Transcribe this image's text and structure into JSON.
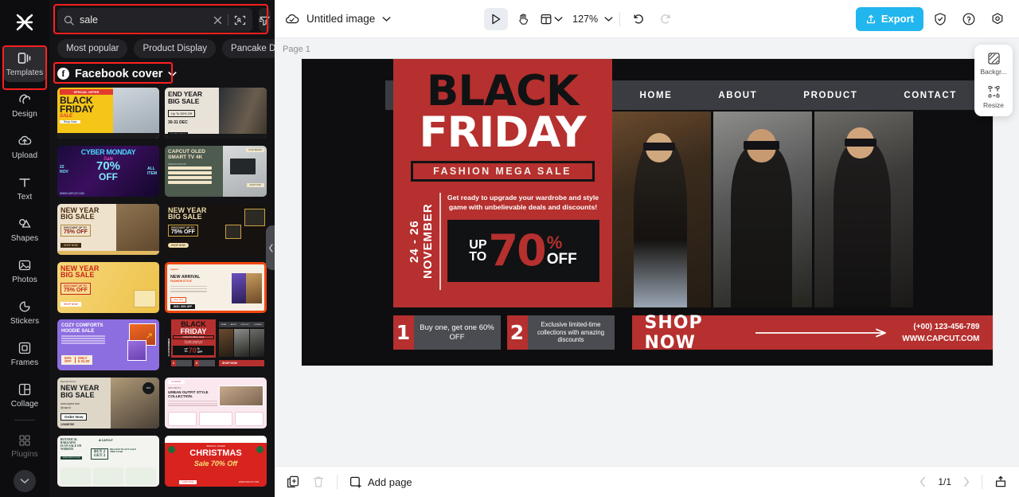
{
  "rail": {
    "logo_icon": "capcut-logo-icon",
    "items": [
      {
        "label": "Templates",
        "icon": "templates-icon",
        "active": true,
        "highlighted": true
      },
      {
        "label": "Design",
        "icon": "design-icon",
        "active": false
      },
      {
        "label": "Upload",
        "icon": "upload-cloud-icon",
        "active": false
      },
      {
        "label": "Text",
        "icon": "text-icon",
        "active": false
      },
      {
        "label": "Shapes",
        "icon": "shapes-icon",
        "active": false
      },
      {
        "label": "Photos",
        "icon": "photos-icon",
        "active": false
      },
      {
        "label": "Stickers",
        "icon": "stickers-icon",
        "active": false
      },
      {
        "label": "Frames",
        "icon": "frames-icon",
        "active": false
      },
      {
        "label": "Collage",
        "icon": "collage-icon",
        "active": false
      },
      {
        "label": "Plugins",
        "icon": "plugins-icon",
        "active": false,
        "dim": true
      }
    ],
    "collapse_icon": "chevron-down-icon"
  },
  "panel": {
    "search": {
      "value": "sale",
      "placeholder": "Search templates",
      "clear_icon": "close-icon",
      "visual_search_icon": "image-search-icon"
    },
    "filter_icon": "filter-icon",
    "chips": [
      "Most popular",
      "Product Display",
      "Pancake Da"
    ],
    "category": {
      "label": "Facebook cover",
      "badge": "f",
      "chevron": "chevron-down-icon"
    },
    "templates": [
      {
        "name": "Black Friday Sale",
        "lines": [
          "SPECIAL OFFER",
          "BLACK",
          "FRIDAY",
          "SALE",
          "Shop Now"
        ]
      },
      {
        "name": "End Year Big Sale",
        "lines": [
          "END YEAR",
          "BIG SALE",
          "Up To 50% Off",
          "30-31 DEC",
          "SHOP NOW"
        ]
      },
      {
        "name": "Cyber Monday Sale",
        "lines": [
          "CYBER MONDAY",
          "Sale",
          "70%",
          "OFF",
          "22 NOV",
          "ALL ITEM",
          "WWW.CAPCUT.COM"
        ]
      },
      {
        "name": "Capcut OLED Smart TV 4K",
        "lines": [
          "CAPCUT OLED",
          "SMART TV 4K",
          "SPECIFICATION",
          "YOUR BRAND",
          "SHOP NOW"
        ]
      },
      {
        "name": "New Year Big Sale Suit",
        "lines": [
          "NEW YEAR",
          "BIG SALE",
          "DISCOUNT UP TO",
          "75% OFF",
          "SHOP NOW"
        ]
      },
      {
        "name": "New Year Big Sale Gifts",
        "lines": [
          "NEW YEAR",
          "BIG SALE",
          "DISCOUNT UP TO",
          "75% OFF",
          "SHOP NOW"
        ]
      },
      {
        "name": "New Year Big Sale Gold",
        "lines": [
          "NEW YEAR",
          "BIG SALE",
          "DISCOUNT UP TO",
          "75% OFF",
          "SHOP NOW"
        ]
      },
      {
        "name": "New Arrival Fashion Style",
        "lines": [
          "NEW ARRIVAL",
          "FASHION STYLE",
          "Shop Now",
          "DISC. 50% OFF"
        ]
      },
      {
        "name": "Cozy Comforts Hoodie Sale",
        "lines": [
          "COZY COMFORTS",
          "HOODIE SALE",
          "50% OFF",
          "ONLY $ 31.00"
        ]
      },
      {
        "name": "Black Friday Fashion Mega Sale",
        "lines": [
          "BLACK",
          "FRIDAY",
          "FASHION MEGA SALE",
          "UP TO 70% OFF",
          "SHOP NOW"
        ]
      },
      {
        "name": "New Year Big Sale Order Now",
        "lines": [
          "NEW YEAR",
          "BIG SALE",
          "www.capcut.com",
          "@capcut",
          "Order Now",
          "123456789"
        ]
      },
      {
        "name": "Urban Outfit Style Collection",
        "lines": [
          "URBAN OUTFIT STYLE",
          "COLLECTION",
          "CAPCUT"
        ]
      },
      {
        "name": "Botanical Bargains",
        "lines": [
          "BOTANICAL BARGAINS IS ON SALE ON WEBSITE",
          "CAPCUT",
          "BUY 2 GET 2",
          "BIGGEST PLANT SALE THIS YEAR"
        ]
      },
      {
        "name": "Christmas Sale 70% Off",
        "lines": [
          "SPECIAL OFFER",
          "CHRISTMAS",
          "Sale 70% Off",
          "SHOP NOW",
          "WWW.CAPCUT.COM"
        ]
      }
    ],
    "collapse_handle_icon": "chevron-left-icon"
  },
  "topbar": {
    "cloud_icon": "cloud-saved-icon",
    "doc_title": "Untitled image",
    "doc_chevron": "chevron-down-icon",
    "tools": [
      {
        "name": "select-tool",
        "icon": "cursor-icon",
        "selected": true
      },
      {
        "name": "hand-tool",
        "icon": "hand-icon",
        "selected": false
      },
      {
        "name": "layout-tool",
        "icon": "layout-icon",
        "selected": false
      }
    ],
    "zoom": "127%",
    "zoom_chevron": "chevron-down-icon",
    "undo_icon": "undo-icon",
    "redo_icon": "redo-icon",
    "export_label": "Export",
    "export_icon": "export-icon",
    "export_color": "#22b6ee",
    "shield_icon": "shield-icon",
    "help_icon": "help-circle-icon",
    "settings_icon": "gear-icon"
  },
  "float_panel": {
    "items": [
      {
        "label": "Backgr...",
        "icon": "background-icon"
      },
      {
        "label": "Resize",
        "icon": "resize-icon"
      }
    ]
  },
  "canvas": {
    "page_label": "Page 1",
    "duplicate_icon": "duplicate-page-icon",
    "more_icon": "more-options-icon",
    "design": {
      "nav": [
        "HOME",
        "ABOUT",
        "PRODUCT",
        "CONTACT"
      ],
      "headline_black": "BLACK",
      "headline_white": "FRIDAY",
      "subtitle": "FASHION MEGA SALE",
      "date": "24 - 26 NOVEMBER",
      "description": "Get ready to upgrade your wardrobe and style game with unbelievable deals and discounts!",
      "up": "UP",
      "to": "TO",
      "discount": "70",
      "percent": "%",
      "off": "OFF",
      "promos": [
        {
          "num": "1",
          "text": "Buy one, get one 60% OFF"
        },
        {
          "num": "2",
          "text": "Exclusive limited-time collections with amazing discounts"
        }
      ],
      "cta": "SHOP NOW",
      "phone": "(+00) 123-456-789",
      "website": "WWW.CAPCUT.COM",
      "red": "#b5302e",
      "black": "#0e0e10"
    }
  },
  "bottombar": {
    "duplicate_icon": "duplicate-icon",
    "delete_icon": "trash-icon",
    "add_page_label": "Add page",
    "add_page_icon": "add-page-icon",
    "prev_icon": "chevron-left-icon",
    "page_count": "1/1",
    "next_icon": "chevron-right-icon",
    "present_icon": "present-icon"
  }
}
